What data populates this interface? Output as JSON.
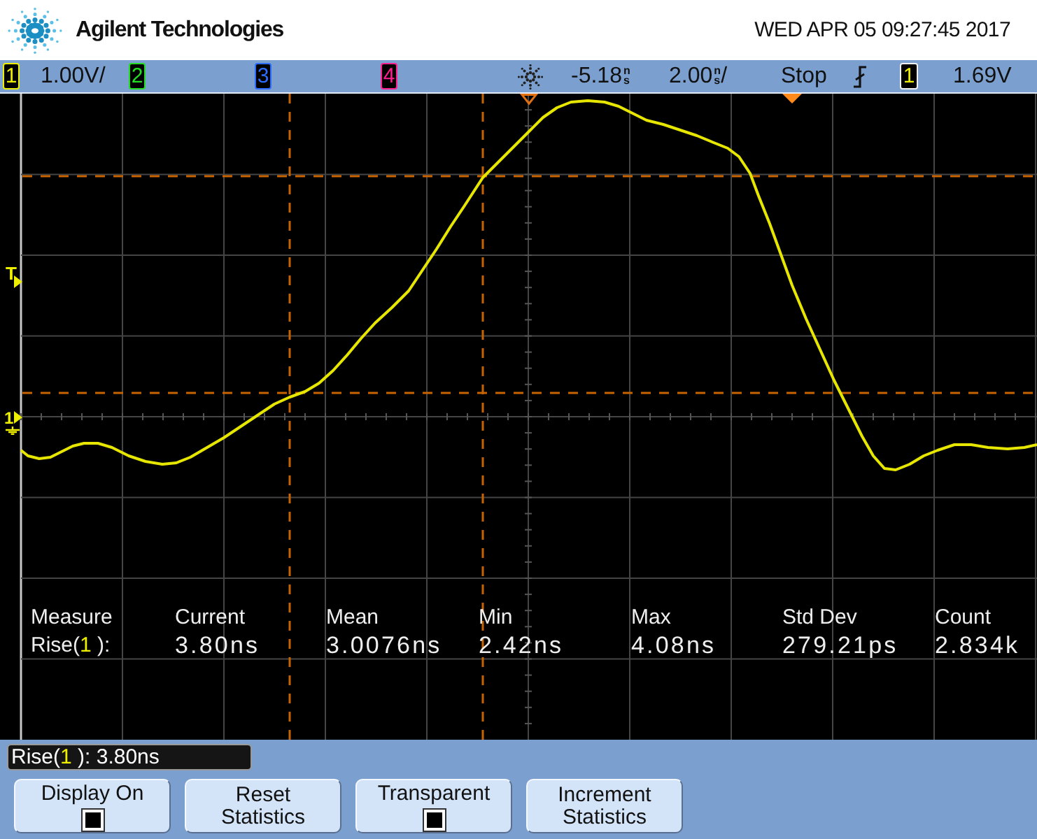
{
  "header": {
    "brand": "Agilent Technologies",
    "datetime": "WED APR 05 09:27:45 2017"
  },
  "status_bar": {
    "channels": [
      {
        "number": "1",
        "color": "#eeee00",
        "scale": "1.00V/"
      },
      {
        "number": "2",
        "color": "#22dd22"
      },
      {
        "number": "3",
        "color": "#2f6bff"
      },
      {
        "number": "4",
        "color": "#ff1f8f"
      }
    ],
    "delay": {
      "value": "-5.18",
      "unit": "ns"
    },
    "timebase": {
      "value": "2.00",
      "unit": "ns",
      "suffix": "/"
    },
    "run_state": "Stop",
    "trigger": {
      "source": "1",
      "level": "1.69V"
    }
  },
  "display": {
    "trigger_marker": "T",
    "ground_marker": "1",
    "statistics": {
      "columns": [
        "Measure",
        "Current",
        "Mean",
        "Min",
        "Max",
        "Std Dev",
        "Count"
      ],
      "rows": [
        {
          "prefix": "Rise(",
          "source": "1",
          "suffix": " ):",
          "values": [
            "3.80ns",
            "3.0076ns",
            "2.42ns",
            "4.08ns",
            "279.21ps",
            "2.834k"
          ]
        }
      ]
    }
  },
  "readout": {
    "prefix": "Rise(",
    "source": "1",
    "suffix": " ): 3.80ns"
  },
  "softkeys": [
    {
      "label": "Display On",
      "kind": "checkbox",
      "checked": true
    },
    {
      "label": "Reset Statistics",
      "kind": "action"
    },
    {
      "label": "Transparent",
      "kind": "checkbox",
      "checked": true
    },
    {
      "label": "Increment Statistics",
      "kind": "action"
    }
  ]
}
